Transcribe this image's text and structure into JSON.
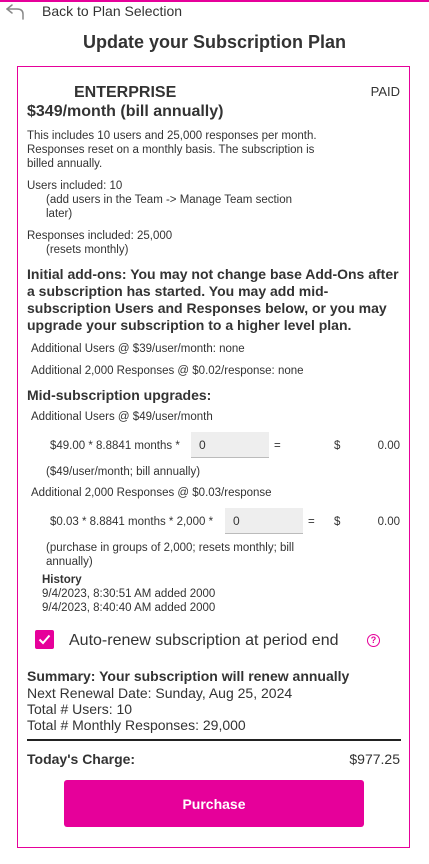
{
  "colors": {
    "accent": "#e6009a",
    "text": "#333333"
  },
  "nav": {
    "back_label": "Back to Plan Selection",
    "back_icon": "back-arrow-icon"
  },
  "page": {
    "title": "Update your Subscription Plan"
  },
  "plan": {
    "name": "ENTERPRISE",
    "status": "PAID",
    "price": "$349/month (bill annually)",
    "description": "This includes 10 users and 25,000 responses per month. Responses reset on a monthly basis. The subscription is billed annually.",
    "users_line": "Users included: 10",
    "users_note": "(add users in the Team -> Manage Team section later)",
    "responses_line": "Responses included: 25,000",
    "responses_note": "(resets monthly)"
  },
  "initial_addons": {
    "notice": "Initial add-ons: You may not change base Add-Ons after a subscription has started. You may add mid-subscription Users and Responses below, or you may upgrade your subscription to a higher level plan.",
    "users": "Additional Users @ $39/user/month: none",
    "responses": "Additional 2,000 Responses @ $0.02/response: none"
  },
  "mid": {
    "title": "Mid-subscription upgrades:",
    "users": {
      "label": "Additional Users @ $49/user/month",
      "formula": "$49.00 * 8.8841 months *",
      "value": "0",
      "equals": "=",
      "currency": "$",
      "total": "0.00",
      "note": "($49/user/month; bill annually)"
    },
    "responses": {
      "label": "Additional 2,000 Responses @ $0.03/response",
      "formula": "$0.03 * 8.8841 months * 2,000 *",
      "value": "0",
      "equals": "=",
      "currency": "$",
      "total": "0.00",
      "note": "(purchase in groups of 2,000; resets monthly; bill annually)"
    },
    "history": {
      "title": "History",
      "entries": [
        "9/4/2023, 8:30:51 AM added 2000",
        "9/4/2023, 8:40:40 AM added 2000"
      ]
    }
  },
  "autorenew": {
    "label": "Auto-renew subscription at period end",
    "checked": true,
    "help_icon": "?"
  },
  "summary": {
    "title": "Summary: Your subscription will renew annually",
    "renewal": "Next Renewal Date: Sunday, Aug 25, 2024",
    "users": "Total # Users: 10",
    "responses": "Total # Monthly Responses: 29,000"
  },
  "charge": {
    "label": "Today's Charge:",
    "value": "$977.25"
  },
  "purchase_label": "Purchase"
}
